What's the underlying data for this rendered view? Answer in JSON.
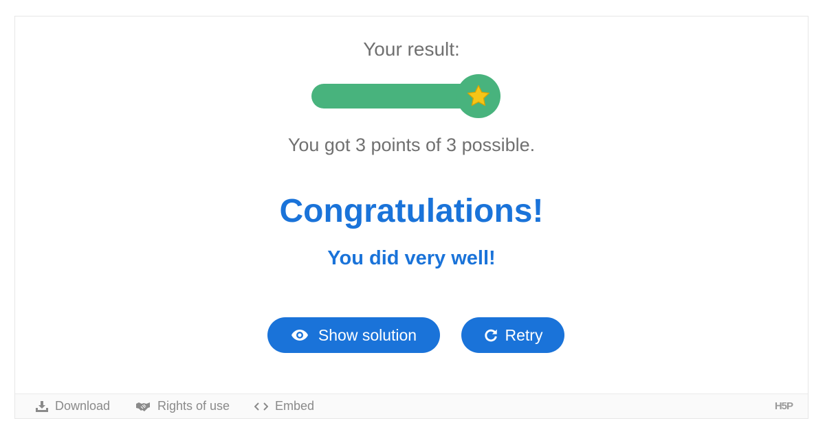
{
  "result": {
    "label": "Your result:",
    "score": 3,
    "max_score": 3,
    "score_fraction": 1.0,
    "points_text": "You got 3 points of 3 possible."
  },
  "feedback": {
    "heading": "Congratulations!",
    "message": "You did very well!"
  },
  "buttons": {
    "show_solution": {
      "label": "Show solution",
      "icon": "eye-icon"
    },
    "retry": {
      "label": "Retry",
      "icon": "retry-icon"
    }
  },
  "footer": {
    "download": {
      "label": "Download",
      "icon": "download-icon"
    },
    "rights": {
      "label": "Rights of use",
      "icon": "handshake-icon"
    },
    "embed": {
      "label": "Embed",
      "icon": "code-icon"
    },
    "logo": "H5P"
  },
  "colors": {
    "accent": "#1a73d9",
    "success": "#48b37d",
    "star": "#f5c518",
    "muted_text": "#707070"
  }
}
